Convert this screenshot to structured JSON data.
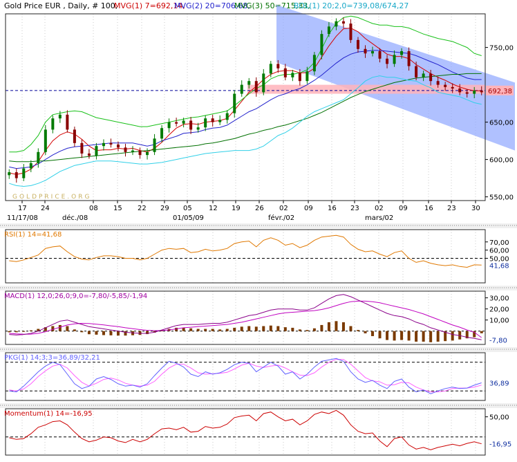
{
  "colors": {
    "panel_bg": "#ffffff",
    "frame": "#222222",
    "grid": "#c8c8c8",
    "channel": "#8fa7ff",
    "zone": "#ffb3ba",
    "ma1": "#d40000",
    "ma2": "#2222cc",
    "ma3": "#007000",
    "bol_up": "#18c018",
    "bol_low": "#30d0e8",
    "candle_up": "#007a00",
    "candle_down": "#8a0000",
    "price_ref": "#000099",
    "rsi": "#e07800",
    "macd": "#cc00cc",
    "macd_sig": "#c000c0",
    "macd_hist": "#7a3a00",
    "stoch_k": "#6060ff",
    "stoch_d": "#ff60ff",
    "mom": "#cc0000"
  },
  "header": {
    "title": "Gold Price EUR , Daily, # 100,",
    "ma1": "MVG(1) 7=692,14,",
    "ma2": "MVG(2) 20=706,68,",
    "ma3": "MVG(3) 50=715,33,",
    "bol": "BOL(1) 20;2,0=739,08/674,27"
  },
  "watermark": "GOLDPRICE.ORG",
  "chart_data": [
    {
      "type": "candlestick",
      "title": "Gold Price EUR , Daily, # 100",
      "ylim": [
        545,
        795
      ],
      "yticks": [
        "550,00",
        "600,00",
        "650,00",
        "700,00",
        "750,00"
      ],
      "xticks": [
        "17",
        "24",
        "08",
        "15",
        "22",
        "29",
        "05",
        "12",
        "19",
        "26",
        "02",
        "09",
        "16",
        "23",
        "02",
        "09",
        "16",
        "23",
        "30"
      ],
      "period_labels": [
        "11/17/08",
        "déc./08",
        "01/05/09",
        "févr./02",
        "mars/02"
      ],
      "last_price_label": "692,38",
      "last_price": 692.38,
      "support_zone": [
        688,
        700
      ],
      "channel": {
        "upper_start": 807,
        "upper_end": 703,
        "lower_start": 730,
        "lower_end": 612
      },
      "close": [
        583,
        575,
        588,
        595,
        610,
        640,
        655,
        660,
        640,
        622,
        608,
        605,
        618,
        622,
        620,
        616,
        610,
        612,
        606,
        610,
        628,
        642,
        650,
        648,
        652,
        640,
        643,
        655,
        650,
        653,
        662,
        688,
        700,
        705,
        690,
        715,
        728,
        722,
        710,
        716,
        705,
        718,
        740,
        768,
        778,
        785,
        782,
        760,
        748,
        742,
        745,
        735,
        728,
        740,
        745,
        725,
        710,
        715,
        705,
        700,
        697,
        695,
        690,
        688,
        692,
        690
      ],
      "series": [
        {
          "name": "MVG(1) 7",
          "values": [
            582,
            580,
            582,
            587,
            597,
            612,
            625,
            633,
            637,
            634,
            627,
            618,
            612,
            613,
            613,
            615,
            614,
            615,
            612,
            610,
            615,
            623,
            633,
            642,
            647,
            648,
            647,
            650,
            651,
            652,
            655,
            666,
            678,
            690,
            698,
            707,
            714,
            718,
            719,
            719,
            716,
            716,
            722,
            737,
            752,
            765,
            775,
            776,
            771,
            762,
            755,
            748,
            741,
            738,
            738,
            735,
            727,
            721,
            715,
            710,
            706,
            701,
            697,
            694,
            692,
            692
          ]
        },
        {
          "name": "MVG(2) 20",
          "values": [
            590,
            588,
            589,
            590,
            594,
            600,
            606,
            611,
            615,
            617,
            618,
            619,
            620,
            621,
            622,
            622,
            622,
            622,
            620,
            618,
            620,
            625,
            628,
            631,
            635,
            636,
            637,
            640,
            642,
            643,
            646,
            652,
            658,
            664,
            668,
            674,
            680,
            685,
            688,
            692,
            695,
            700,
            706,
            713,
            721,
            729,
            736,
            741,
            744,
            745,
            746,
            746,
            745,
            744,
            743,
            742,
            739,
            735,
            731,
            727,
            722,
            717,
            713,
            709,
            707,
            707
          ]
        },
        {
          "name": "MVG(3) 50",
          "values": [
            598,
            597,
            597,
            597,
            598,
            598,
            599,
            600,
            601,
            602,
            603,
            604,
            605,
            606,
            607,
            608,
            609,
            610,
            611,
            612,
            613,
            614,
            615,
            616,
            617,
            618,
            619,
            621,
            622,
            624,
            626,
            628,
            631,
            634,
            636,
            639,
            641,
            644,
            646,
            649,
            652,
            655,
            659,
            663,
            668,
            673,
            678,
            683,
            687,
            691,
            694,
            697,
            700,
            703,
            705,
            707,
            709,
            710,
            711,
            712,
            713,
            714,
            714,
            715,
            715,
            715
          ]
        },
        {
          "name": "BOL upper",
          "values": [
            610,
            610,
            612,
            620,
            632,
            650,
            660,
            662,
            664,
            665,
            664,
            660,
            656,
            654,
            652,
            650,
            648,
            646,
            644,
            644,
            646,
            648,
            650,
            652,
            654,
            656,
            657,
            659,
            661,
            663,
            665,
            672,
            680,
            688,
            695,
            700,
            708,
            712,
            714,
            714,
            716,
            720,
            730,
            748,
            768,
            782,
            790,
            792,
            790,
            786,
            782,
            780,
            780,
            778,
            778,
            776,
            772,
            768,
            765,
            762,
            760,
            758,
            754,
            750,
            742,
            739
          ]
        },
        {
          "name": "BOL lower",
          "values": [
            568,
            565,
            564,
            565,
            568,
            572,
            578,
            584,
            588,
            592,
            594,
            596,
            598,
            598,
            598,
            597,
            596,
            595,
            594,
            594,
            595,
            596,
            598,
            600,
            602,
            604,
            606,
            608,
            609,
            610,
            611,
            612,
            612,
            612,
            614,
            618,
            625,
            632,
            636,
            642,
            650,
            658,
            664,
            668,
            672,
            676,
            680,
            688,
            696,
            705,
            710,
            712,
            710,
            710,
            708,
            706,
            705,
            700,
            696,
            690,
            688,
            686,
            684,
            680,
            676,
            674
          ]
        }
      ]
    },
    {
      "type": "line",
      "title": "RSI(1) 14=41,68",
      "ylim": [
        20,
        85
      ],
      "yticks": [
        "50,00",
        "60,00",
        "70,00"
      ],
      "ref_level": 50,
      "last_label": "41,68",
      "series": [
        {
          "name": "RSI(1) 14",
          "values": [
            47,
            46,
            48,
            51,
            54,
            62,
            64,
            65,
            58,
            52,
            49,
            48,
            51,
            53,
            53,
            52,
            50,
            50,
            48,
            50,
            55,
            60,
            62,
            61,
            62,
            57,
            58,
            61,
            59,
            60,
            62,
            68,
            70,
            71,
            64,
            72,
            75,
            72,
            66,
            68,
            63,
            66,
            72,
            76,
            77,
            78,
            76,
            67,
            61,
            58,
            59,
            55,
            52,
            57,
            59,
            50,
            45,
            47,
            44,
            42,
            41,
            42,
            40,
            39,
            42,
            41.68
          ]
        }
      ]
    },
    {
      "type": "line",
      "title": "MACD(1) 12,0;26,0;9,0=-7,80/-5,85/-1,94",
      "ylim": [
        -12,
        36
      ],
      "yticks": [
        "10,00",
        "20,00",
        "30,00"
      ],
      "last_label": "-7,80",
      "series": [
        {
          "name": "MACD",
          "values": [
            -3,
            -3.5,
            -3,
            -2,
            0,
            3,
            6,
            9,
            10,
            8,
            6,
            4,
            3,
            2,
            1,
            0,
            -1,
            -1.5,
            -2,
            -2,
            -1,
            1,
            3,
            5,
            6,
            6,
            6,
            6.5,
            7,
            7,
            8,
            10,
            12,
            14,
            15,
            17,
            19,
            20,
            20,
            20,
            19,
            19,
            21,
            25,
            29,
            32,
            33,
            31,
            28,
            25,
            22,
            19,
            16,
            14,
            13,
            11,
            8,
            6,
            3,
            1,
            -1,
            -3,
            -4,
            -5.5,
            -6.5,
            -7.8
          ]
        },
        {
          "name": "Signal",
          "values": [
            -2,
            -2.5,
            -2.8,
            -2.7,
            -2,
            -0.5,
            1.5,
            3.5,
            5.5,
            6.5,
            7,
            6.8,
            6.2,
            5.6,
            4.8,
            4,
            3,
            2.2,
            1.4,
            0.7,
            0.4,
            0.5,
            1,
            2,
            3,
            3.5,
            4,
            4.5,
            5,
            5.5,
            6,
            7,
            8,
            9.5,
            11,
            12.5,
            14,
            15.5,
            16.5,
            17,
            17.5,
            18,
            18.5,
            19.5,
            21,
            23,
            25,
            26.5,
            27,
            27,
            26.5,
            25.5,
            24,
            22.5,
            21,
            19.5,
            17.5,
            15.5,
            13,
            10.5,
            8,
            5.5,
            3.5,
            1,
            -1,
            -5.85
          ]
        },
        {
          "name": "Histogram",
          "values": [
            -1,
            -1,
            -0.2,
            0.7,
            2,
            3.5,
            4.5,
            5.5,
            4.5,
            1.5,
            -1,
            -2.8,
            -3.2,
            -3.6,
            -3.8,
            -4,
            -4,
            -3.7,
            -3.4,
            -2.7,
            -1.4,
            0.5,
            2,
            3,
            3,
            2.5,
            2,
            2,
            2,
            1.5,
            2,
            3,
            4,
            4.5,
            4,
            4.5,
            5,
            4.5,
            3.5,
            3,
            1.5,
            1,
            2.5,
            5.5,
            8,
            9,
            8,
            4.5,
            1,
            -2,
            -4.5,
            -6.5,
            -8,
            -8.5,
            -8,
            -8.5,
            -9.5,
            -9.5,
            -10,
            -9.5,
            -9,
            -8.5,
            -7.5,
            -6.5,
            -5.5,
            -1.94
          ]
        }
      ]
    },
    {
      "type": "line",
      "title": "PKG(1) 14;3;3=36,89/32,21",
      "ylim": [
        0,
        100
      ],
      "ref_levels": [
        20,
        80
      ],
      "last_label": "36,89",
      "series": [
        {
          "name": "%K",
          "values": [
            20,
            18,
            30,
            45,
            60,
            72,
            80,
            75,
            55,
            35,
            25,
            30,
            45,
            50,
            44,
            35,
            30,
            32,
            28,
            35,
            52,
            68,
            82,
            78,
            70,
            55,
            50,
            60,
            55,
            58,
            65,
            75,
            80,
            78,
            60,
            70,
            80,
            72,
            55,
            60,
            45,
            55,
            70,
            82,
            85,
            88,
            82,
            60,
            45,
            38,
            42,
            32,
            25,
            40,
            45,
            28,
            18,
            22,
            14,
            20,
            25,
            28,
            25,
            26,
            32,
            36.89
          ]
        },
        {
          "name": "%D",
          "values": [
            22,
            20,
            24,
            35,
            50,
            62,
            72,
            76,
            68,
            52,
            38,
            30,
            36,
            44,
            47,
            43,
            36,
            32,
            30,
            32,
            40,
            55,
            68,
            76,
            76,
            68,
            58,
            55,
            56,
            57,
            59,
            66,
            74,
            78,
            72,
            69,
            72,
            74,
            68,
            60,
            53,
            52,
            58,
            70,
            80,
            86,
            86,
            76,
            62,
            48,
            41,
            39,
            32,
            33,
            38,
            37,
            28,
            22,
            18,
            18,
            20,
            25,
            26,
            26,
            28,
            32.21
          ]
        }
      ]
    },
    {
      "type": "line",
      "title": "Momentum(1) 14=-16,95",
      "ylim": [
        -45,
        70
      ],
      "yticks": [
        "50,00"
      ],
      "ref_level": 0,
      "last_label": "-16,95",
      "series": [
        {
          "name": "Momentum(1) 14",
          "values": [
            -2,
            -6,
            -4,
            8,
            24,
            30,
            38,
            40,
            30,
            12,
            -4,
            -12,
            -8,
            0,
            -2,
            -10,
            -14,
            -6,
            -12,
            -6,
            8,
            20,
            22,
            18,
            24,
            12,
            14,
            26,
            22,
            24,
            32,
            48,
            52,
            54,
            40,
            58,
            62,
            50,
            40,
            44,
            30,
            40,
            56,
            62,
            58,
            66,
            54,
            30,
            14,
            8,
            10,
            -10,
            -24,
            -4,
            0,
            -20,
            -30,
            -26,
            -32,
            -26,
            -22,
            -18,
            -22,
            -16,
            -12,
            -16.95
          ]
        }
      ]
    }
  ]
}
